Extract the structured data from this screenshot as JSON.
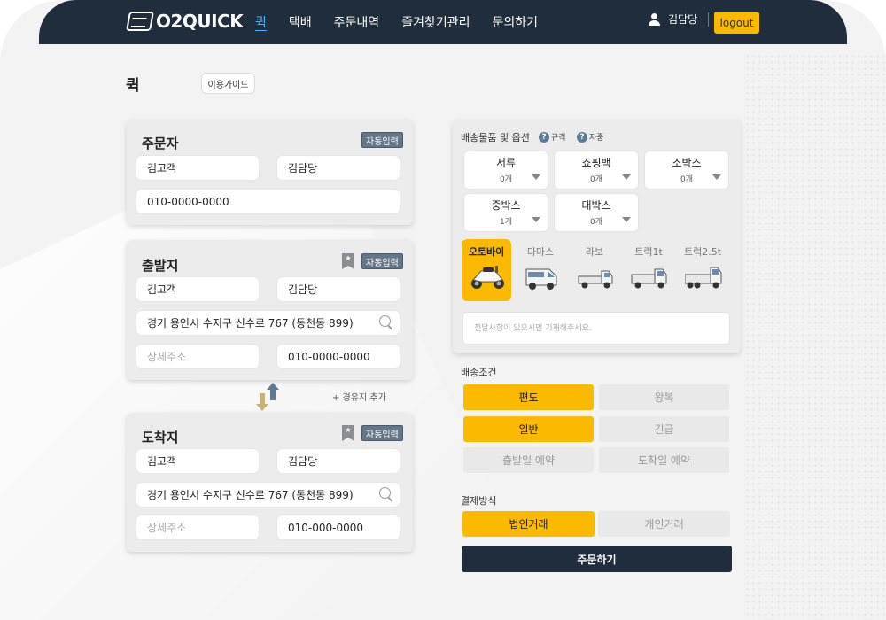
{
  "header": {
    "logo_text": "O2QUICK",
    "nav": [
      "퀵",
      "택배",
      "주문내역",
      "즐겨찾기관리",
      "문의하기"
    ],
    "user_name": "김담당",
    "logout_label": "logout"
  },
  "page": {
    "title": "퀵",
    "guide_label": "이용가이드"
  },
  "autofill_label": "자동입력",
  "bookmark_mark": "★",
  "orderer": {
    "title": "주문자",
    "customer": "김고객",
    "manager": "김담당",
    "phone": "010-0000-0000"
  },
  "departure": {
    "title": "출발지",
    "customer": "김고객",
    "manager": "김담당",
    "address": "경기 용인시 수지구 신수로 767 (동천동 899)",
    "detail_placeholder": "상세주소",
    "phone": "010-0000-0000"
  },
  "waypoint_label": "+ 경유지 추가",
  "arrival": {
    "title": "도착지",
    "customer": "김고객",
    "manager": "김담당",
    "address": "경기 용인시 수지구 신수로 767 (동천동 899)",
    "detail_placeholder": "상세주소",
    "phone": "010-000-0000"
  },
  "options": {
    "title": "배송물품 및 옵션",
    "help_spec": "규격",
    "help_weight": "자중",
    "help_glyph": "?",
    "items": [
      {
        "name": "서류",
        "qty": "0개"
      },
      {
        "name": "쇼핑백",
        "qty": "0개"
      },
      {
        "name": "소박스",
        "qty": "0개"
      },
      {
        "name": "중박스",
        "qty": "1개"
      },
      {
        "name": "대박스",
        "qty": "0개"
      }
    ],
    "vehicles": [
      "오토바이",
      "다마스",
      "라보",
      "트럭1t",
      "트럭2.5t"
    ],
    "selected_vehicle": "오토바이",
    "memo_placeholder": "전달사항이 있으시면 기재해주세요."
  },
  "conditions": {
    "title": "배송조건",
    "buttons": [
      "편도",
      "왕복",
      "일반",
      "긴급",
      "출발일 예약",
      "도착일 예약"
    ],
    "selected": [
      "편도",
      "일반"
    ]
  },
  "payment": {
    "title": "결제방식",
    "buttons": [
      "법인거래",
      "개인거래"
    ],
    "selected": "법인거래"
  },
  "order_label": "주문하기",
  "colors": {
    "header": "#1f2d3d",
    "accent": "#fbb900",
    "autofill": "#64778a"
  }
}
